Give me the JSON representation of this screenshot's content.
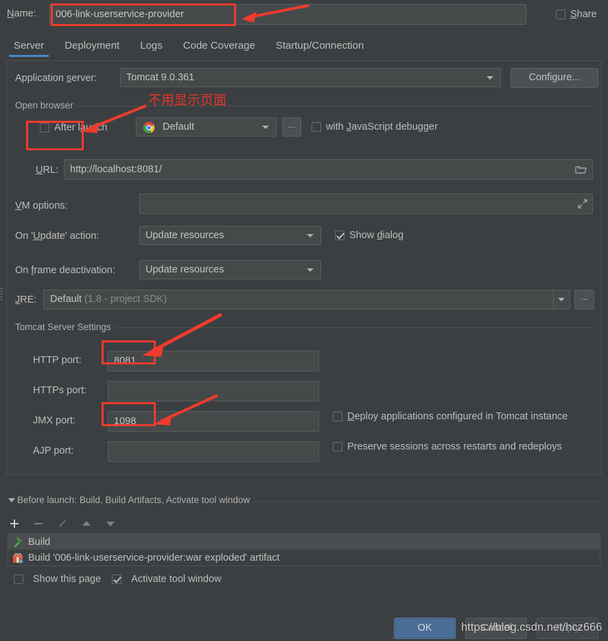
{
  "name_row": {
    "label": "Name:",
    "value": "006-link-userservice-provider",
    "share_label": "Share",
    "share_checked": false
  },
  "tabs": [
    {
      "label": "Server",
      "selected": true
    },
    {
      "label": "Deployment",
      "selected": false
    },
    {
      "label": "Logs",
      "selected": false
    },
    {
      "label": "Code Coverage",
      "selected": false
    },
    {
      "label": "Startup/Connection",
      "selected": false
    }
  ],
  "server_tab": {
    "application_server": {
      "label": "Application server:",
      "value": "Tomcat 9.0.361",
      "configure_button": "Configure..."
    },
    "open_browser": {
      "legend": "Open browser",
      "after_launch_label": "After launch",
      "after_launch_checked": false,
      "browser_value": "Default",
      "browser_icon": "chrome-icon",
      "ellipsis_button": "...",
      "js_debugger_label": "with JavaScript debugger",
      "js_debugger_checked": false
    },
    "url": {
      "label": "URL:",
      "value": "http://localhost:8081/",
      "browse_icon": "folder-icon"
    },
    "vm_options": {
      "label": "VM options:",
      "value": "",
      "expand_icon": "expand-icon"
    },
    "on_update_action": {
      "label": "On 'Update' action:",
      "value": "Update resources",
      "show_dialog_label": "Show dialog",
      "show_dialog_checked": true
    },
    "on_frame_deactivation": {
      "label": "On frame deactivation:",
      "value": "Update resources"
    },
    "jre": {
      "label": "JRE:",
      "value": "Default",
      "value_sub": "(1.8 - project SDK)",
      "ellipsis_button": "..."
    },
    "tomcat_settings": {
      "legend": "Tomcat Server Settings",
      "ports": [
        {
          "label": "HTTP port:",
          "value": "8081"
        },
        {
          "label": "HTTPs port:",
          "value": ""
        },
        {
          "label": "JMX port:",
          "value": "1098"
        },
        {
          "label": "AJP port:",
          "value": ""
        }
      ],
      "deploy_label": "Deploy applications configured in Tomcat instance",
      "deploy_checked": false,
      "preserve_label": "Preserve sessions across restarts and redeploys",
      "preserve_checked": false
    }
  },
  "before_launch": {
    "title": "Before launch: Build, Build Artifacts, Activate tool window",
    "toolbar": [
      "add-icon",
      "remove-icon",
      "edit-icon",
      "move-up-icon",
      "move-down-icon"
    ],
    "items": [
      {
        "icon": "hammer-icon",
        "text": "Build",
        "selected": true
      },
      {
        "icon": "artifact-icon",
        "text": "Build '006-link-userservice-provider:war exploded' artifact",
        "selected": false
      }
    ],
    "show_this_page_label": "Show this page",
    "show_this_page_checked": false,
    "activate_tool_window_label": "Activate tool window",
    "activate_tool_window_checked": true
  },
  "buttons": {
    "ok": "OK",
    "cancel": "Cancel",
    "apply": "Apply"
  },
  "annotations": {
    "chinese_note": "不用显示页面",
    "accent_red": "#ef3b2d"
  },
  "watermark": "https://blog.csdn.net/hcz666"
}
